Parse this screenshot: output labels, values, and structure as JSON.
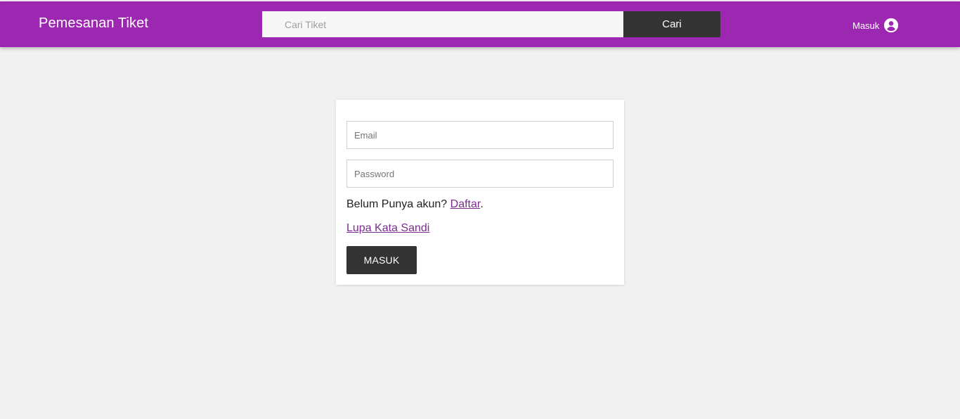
{
  "header": {
    "brand": "Pemesanan Tiket",
    "search": {
      "placeholder": "Cari Tiket",
      "value": "",
      "button_label": "Cari"
    },
    "login_label": "Masuk",
    "login_icon": "account-circle-icon",
    "background_color": "#9c27b0"
  },
  "login_form": {
    "email_placeholder": "Email",
    "password_placeholder": "Password",
    "register_prompt": "Belum Punya akun?",
    "register_link": "Daftar",
    "register_suffix": ".",
    "forgot_password_link": "Lupa Kata Sandi",
    "submit_label": "MASUK"
  },
  "colors": {
    "accent": "#9c27b0",
    "link": "#7b2c8f",
    "dark_button": "#333333",
    "page_background": "#f1f1f1"
  }
}
